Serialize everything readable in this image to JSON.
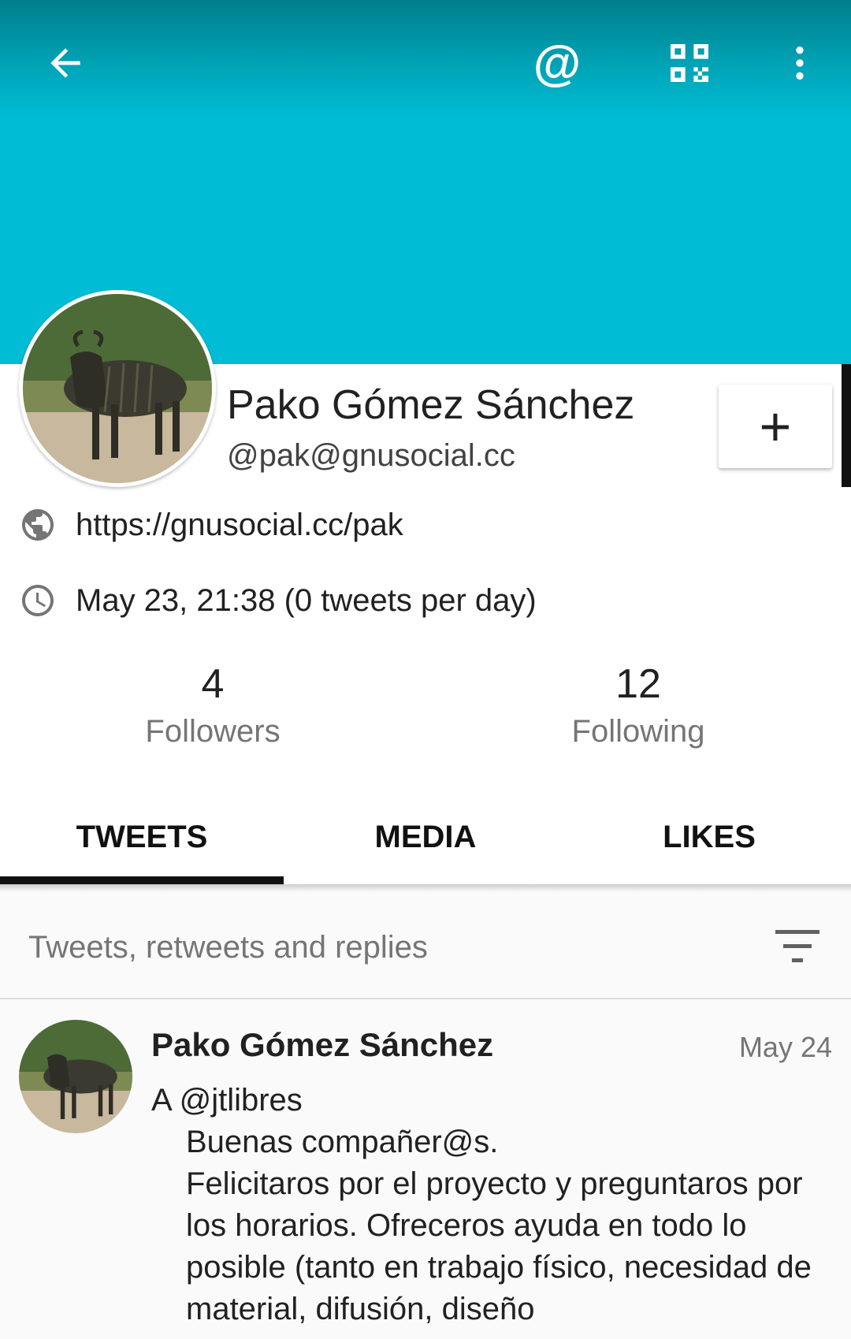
{
  "toolbar": {
    "mention_label": "@"
  },
  "profile": {
    "name": "Pako Gómez Sánchez",
    "handle": "@pak@gnusocial.cc",
    "url": "https://gnusocial.cc/pak",
    "joined": "May 23, 21:38 (0 tweets per day)",
    "follow_label": "+"
  },
  "stats": {
    "followers_count": "4",
    "followers_label": "Followers",
    "following_count": "12",
    "following_label": "Following"
  },
  "tabs": [
    {
      "label": "TWEETS",
      "active": true
    },
    {
      "label": "MEDIA",
      "active": false
    },
    {
      "label": "LIKES",
      "active": false
    }
  ],
  "filter": {
    "label": "Tweets, retweets and replies"
  },
  "tweets": [
    {
      "author": "Pako Gómez Sánchez",
      "date": "May 24",
      "lines": [
        "A @jtlibres",
        "Buenas compañer@s.",
        "Felicitaros por el proyecto y preguntaros por los horarios. Ofreceros ayuda en todo lo posible (tanto en trabajo físico, necesidad de material, difusión, diseño"
      ]
    }
  ],
  "colors": {
    "banner": "#00bcd4",
    "banner_top": "#007f8c",
    "accent": "#111111"
  },
  "icons": [
    "back-arrow-icon",
    "at-icon",
    "qr-code-icon",
    "more-vert-icon",
    "globe-icon",
    "clock-icon",
    "filter-icon"
  ]
}
